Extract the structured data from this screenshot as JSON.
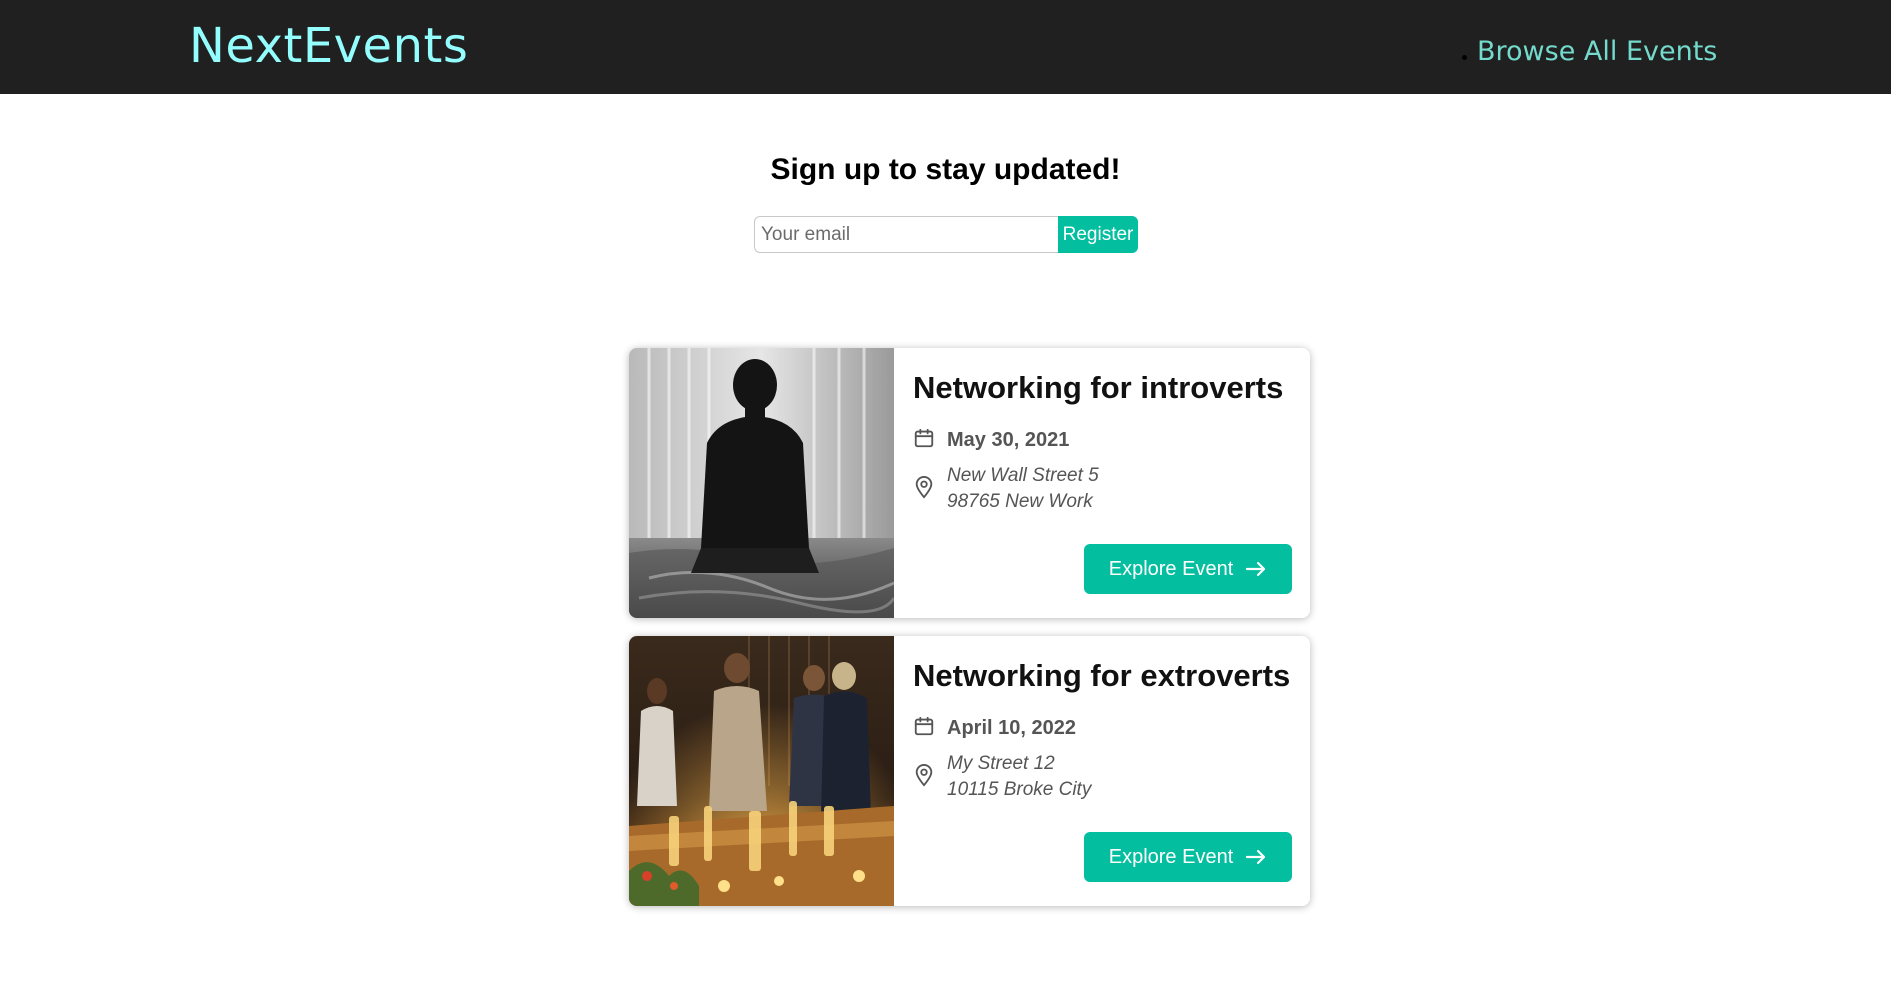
{
  "header": {
    "logo": "NextEvents",
    "nav_link": "Browse All Events"
  },
  "signup": {
    "title": "Sign up to stay updated!",
    "email_placeholder": "Your email",
    "register_label": "Register"
  },
  "events": [
    {
      "title": "Networking for introverts",
      "date": "May 30, 2021",
      "address_line1": "New Wall Street 5",
      "address_line2": "98765 New Work",
      "button_label": "Explore Event"
    },
    {
      "title": "Networking for extroverts",
      "date": "April 10, 2022",
      "address_line1": "My Street 12",
      "address_line2": "10115 Broke City",
      "button_label": "Explore Event"
    }
  ],
  "icons": {
    "date": "calendar-icon",
    "address": "location-pin-icon",
    "button": "arrow-right-icon"
  },
  "colors": {
    "header_bg": "#202020",
    "logo": "#94fdfd",
    "nav_link": "#74dacc",
    "accent": "#03be9f"
  }
}
